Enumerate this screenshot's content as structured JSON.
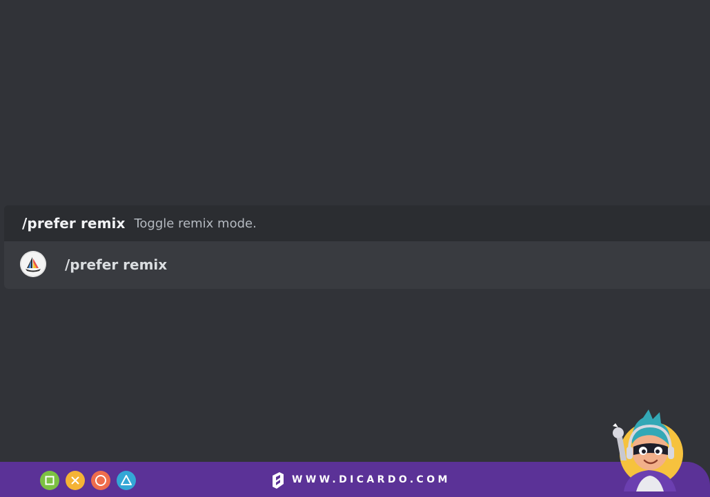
{
  "command_popup": {
    "header": {
      "command": "/prefer remix",
      "description": "Toggle remix mode."
    },
    "option": {
      "avatar_icon": "midjourney-bot-avatar-icon",
      "label": "/prefer remix"
    }
  },
  "brand_bar": {
    "buttons": [
      {
        "icon": "square-icon",
        "color": "#7cc142"
      },
      {
        "icon": "cross-icon",
        "color": "#f5b335"
      },
      {
        "icon": "circle-icon",
        "color": "#ee6d4c"
      },
      {
        "icon": "triangle-icon",
        "color": "#34a7d6"
      }
    ],
    "logo_icon": "dicardo-logo-icon",
    "site": "WWW.DICARDO.COM",
    "mascot_icon": "mascot-character-icon"
  },
  "colors": {
    "background": "#313338",
    "popup": "#2b2d31",
    "option_highlight": "#393b40",
    "brand_purple": "#5b3297"
  }
}
